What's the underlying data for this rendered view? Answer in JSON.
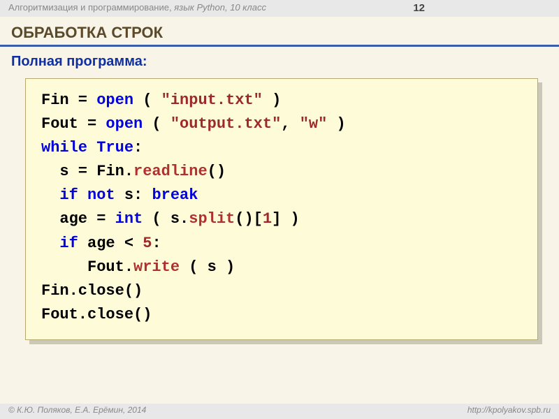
{
  "header": {
    "course_title_plain": "Алгоритмизация и программирование, ",
    "course_title_italic": "язык Python, 10 класс",
    "page_number": "12"
  },
  "section_title": "Обработка строк",
  "subheading": "Полная программа:",
  "code": {
    "l1_a": "Fin = ",
    "l1_kw": "open",
    "l1_b": " ( ",
    "l1_str": "\"input.txt\"",
    "l1_c": " )",
    "l2_a": "Fout = ",
    "l2_kw": "open",
    "l2_b": " ( ",
    "l2_str1": "\"output.txt\"",
    "l2_c": ", ",
    "l2_str2": "\"w\"",
    "l2_d": " )",
    "l3_kw1": "while",
    "l3_sp": " ",
    "l3_kw2": "True",
    "l3_a": ":",
    "l4_a": "  s = Fin.",
    "l4_fn": "readline",
    "l4_b": "()",
    "l5_a": "  ",
    "l5_kw1": "if",
    "l5_b": " ",
    "l5_kw2": "not",
    "l5_c": " s: ",
    "l5_kw3": "break",
    "l6_a": "  age = ",
    "l6_kw": "int",
    "l6_b": " ( s.",
    "l6_fn": "split",
    "l6_c": "()[",
    "l6_num": "1",
    "l6_d": "] )",
    "l7_a": "  ",
    "l7_kw": "if",
    "l7_b": " age < ",
    "l7_num": "5",
    "l7_c": ":",
    "l8_a": "     Fout.",
    "l8_fn": "write",
    "l8_b": " ( s )",
    "l9_a": "Fin.close()",
    "l10_a": "Fout.close()"
  },
  "footer": {
    "copyright": "© К.Ю. Поляков, Е.А. Ерёмин, 2014",
    "url": "http://kpolyakov.spb.ru"
  }
}
